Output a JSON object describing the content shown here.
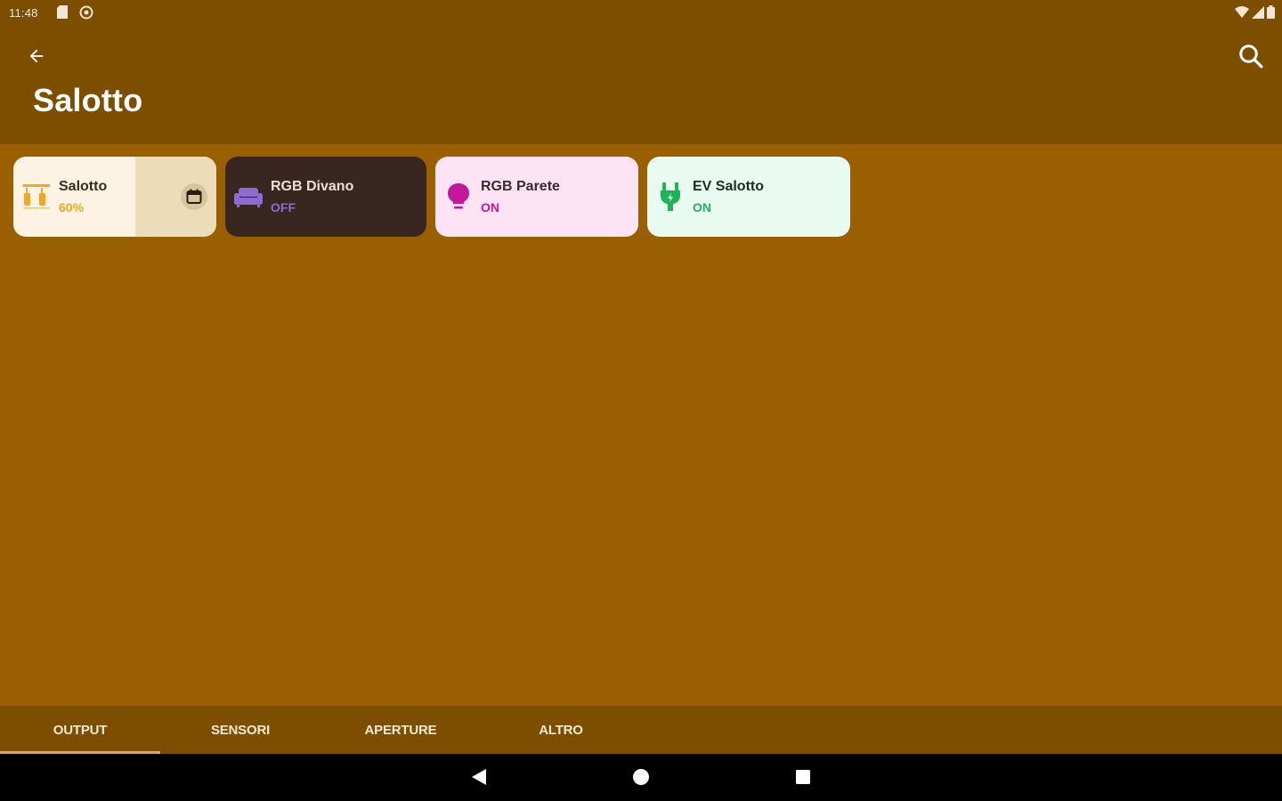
{
  "status_bar": {
    "time": "11:48",
    "icons": [
      "sd-card-icon",
      "sync-icon",
      "wifi-icon",
      "cell-signal-icon",
      "battery-icon"
    ]
  },
  "app_bar": {
    "title": "Salotto",
    "back_icon": "arrow-back-icon",
    "search_icon": "search-icon"
  },
  "tiles": [
    {
      "name": "Salotto",
      "state": "60%",
      "level": 0.6,
      "icon": "shutter-icon",
      "action_icon": "calendar-icon",
      "bg": "#fdf3e4",
      "name_color": "#3a2b1a",
      "state_color": "#f2a825",
      "icon_color": "#f2a825"
    },
    {
      "name": "RGB Divano",
      "state": "OFF",
      "icon": "sofa-icon",
      "bg": "#3a2620",
      "name_color": "#eadfd6",
      "state_color": "#8f6bd1",
      "icon_color": "#8f6bd1"
    },
    {
      "name": "RGB Parete",
      "state": "ON",
      "icon": "lightbulb-icon",
      "bg": "#fde3f4",
      "name_color": "#3a2b2f",
      "state_color": "#c2189b",
      "icon_color": "#c2189b"
    },
    {
      "name": "EV Salotto",
      "state": "ON",
      "icon": "plug-icon",
      "bg": "#e9fbf1",
      "name_color": "#1f2b25",
      "state_color": "#1fb257",
      "icon_color": "#1fb257"
    }
  ],
  "tabs": [
    {
      "label": "OUTPUT",
      "selected": true
    },
    {
      "label": "SENSORI",
      "selected": false
    },
    {
      "label": "APERTURE",
      "selected": false
    },
    {
      "label": "ALTRO",
      "selected": false
    }
  ],
  "nav_bar": {
    "icons": [
      "back-triangle-icon",
      "home-circle-icon",
      "recents-square-icon"
    ]
  },
  "colors": {
    "background": "#995f00",
    "app_bar": "#7d4e00",
    "tab_indicator": "#cfa979"
  }
}
